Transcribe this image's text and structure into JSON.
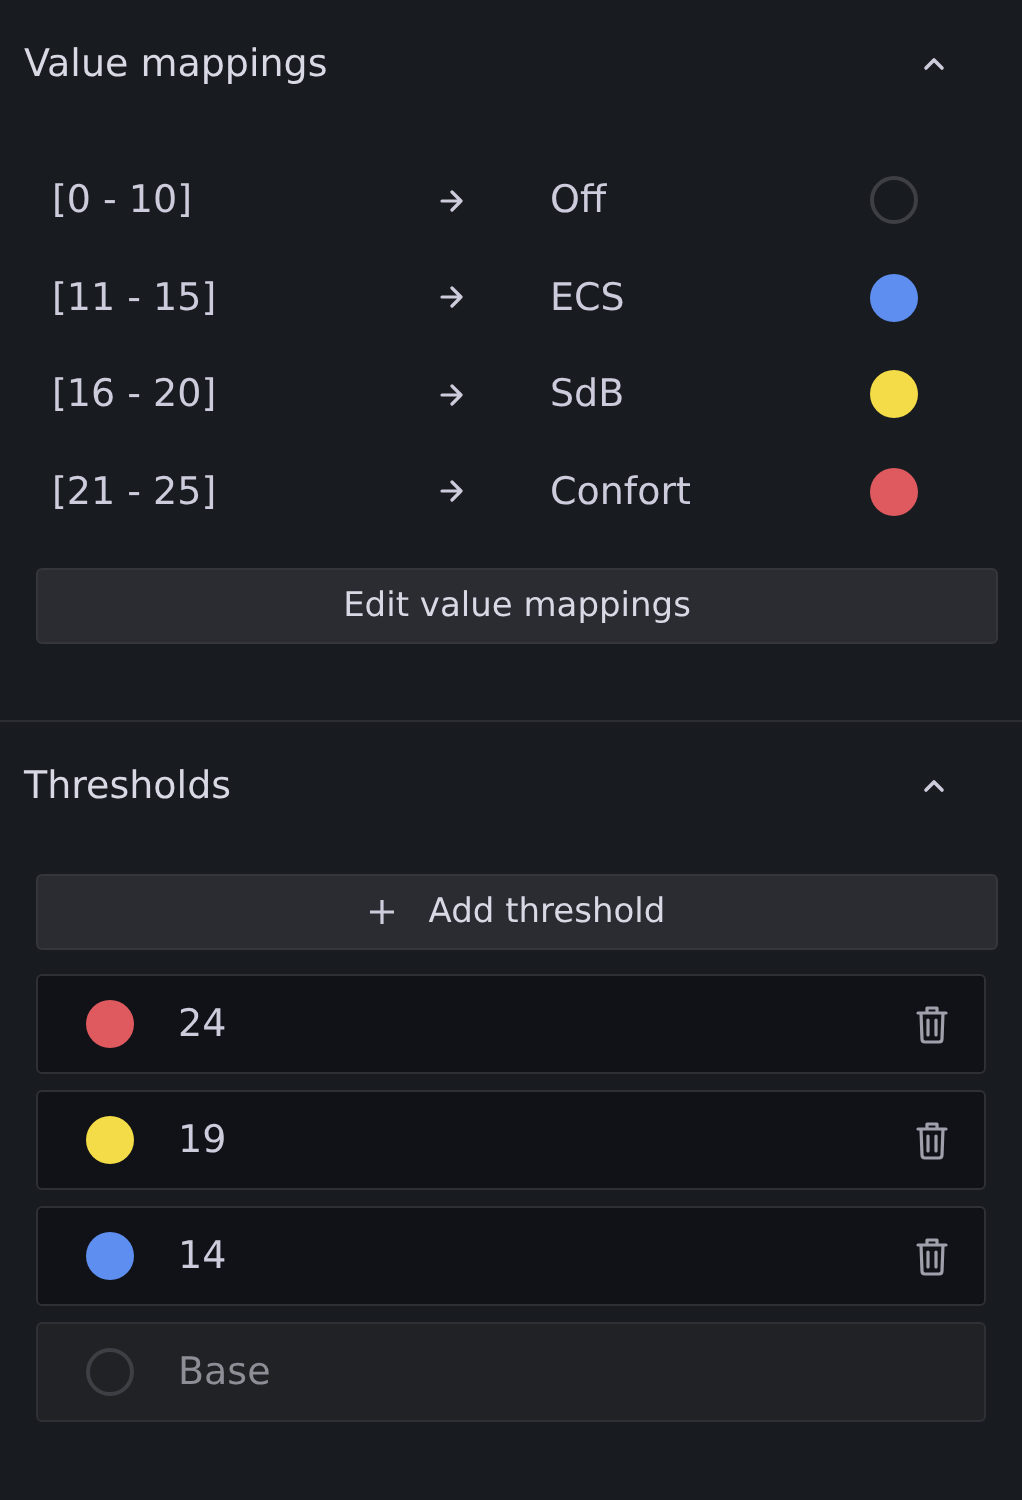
{
  "sections": [
    {
      "title": "Value mappings",
      "expanded": true,
      "kind": "mappings",
      "mappings": [
        {
          "range": "[0 - 10]",
          "text": "Off",
          "kind": "transparent"
        },
        {
          "range": "[11 - 15]",
          "text": "ECS",
          "kind": "color",
          "color": "#5e8ff0"
        },
        {
          "range": "[16 - 20]",
          "text": "SdB",
          "kind": "color",
          "color": "#f3dc47"
        },
        {
          "range": "[21 - 25]",
          "text": "Confort",
          "kind": "color",
          "color": "#de5a5e"
        }
      ],
      "button": "Edit value mappings"
    },
    {
      "title": "Thresholds",
      "expanded": true,
      "kind": "thresholds",
      "button": "Add threshold",
      "thresholds": [
        {
          "value": "24",
          "kind": "step",
          "color": "#de5a5e"
        },
        {
          "value": "19",
          "kind": "step",
          "color": "#f3dc47"
        },
        {
          "value": "14",
          "kind": "step",
          "color": "#5e8ff0"
        },
        {
          "value": "Base",
          "kind": "base"
        }
      ]
    }
  ]
}
